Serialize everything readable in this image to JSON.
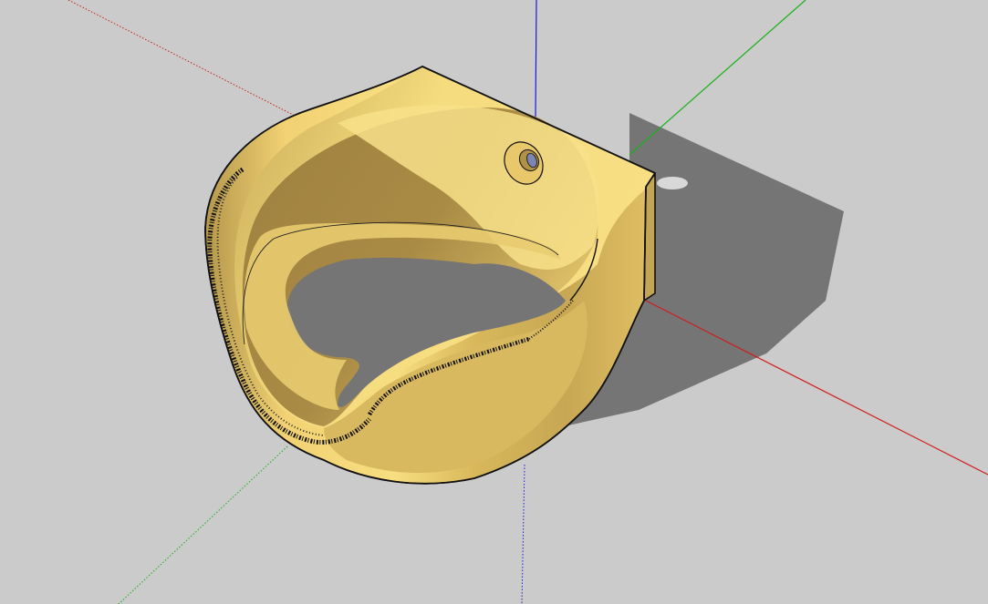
{
  "viewport": {
    "background_color": "#cbcbcb"
  },
  "axes": {
    "red_color": "#d11a1a",
    "green_color": "#19b019",
    "blue_color": "#1a1ad4"
  },
  "model": {
    "material_light": "#f7de80",
    "material_mid": "#e4c466",
    "material_dark": "#a98b44",
    "edge_color": "#111111",
    "shadow_color": "#757575",
    "hole_color": "#7c86b0"
  }
}
